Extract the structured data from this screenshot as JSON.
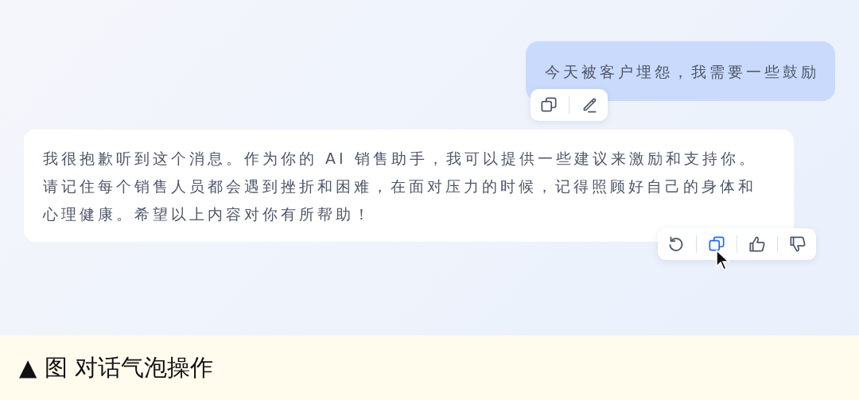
{
  "messages": [
    {
      "kind": "user",
      "text": "今天被客户埋怨，我需要一些鼓励",
      "actions": [
        {
          "kind": "copy",
          "hovered": false
        },
        {
          "kind": "edit",
          "hovered": false
        }
      ]
    },
    {
      "kind": "assistant",
      "text": "我很抱歉听到这个消息。作为你的 AI 销售助手，我可以提供一些建议来激励和支持你。请记住每个销售人员都会遇到挫折和困难，在面对压力的时候，记得照顾好自己的身体和心理健康。希望以上内容对你有所帮助！",
      "actions": [
        {
          "kind": "regenerate",
          "hovered": false
        },
        {
          "kind": "copy",
          "hovered": true
        },
        {
          "kind": "like",
          "hovered": false
        },
        {
          "kind": "dislike",
          "hovered": false
        }
      ]
    }
  ],
  "caption": "▲ 图 对话气泡操作"
}
